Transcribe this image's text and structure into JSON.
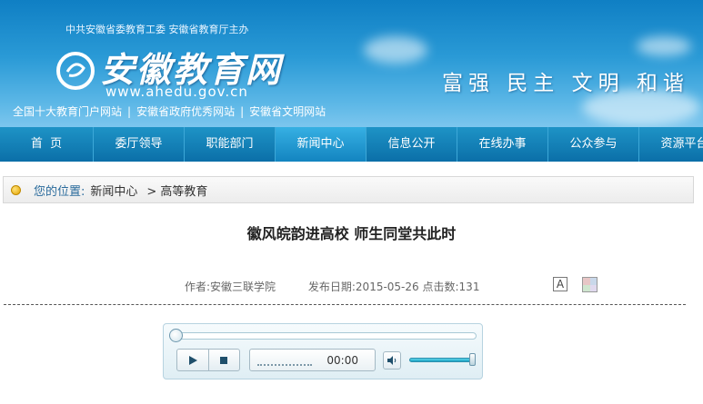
{
  "header": {
    "sponsor": "中共安徽省委教育工委  安徽省教育厅主办",
    "site_name": "安徽教育网",
    "url": "www.ahedu.gov.cn",
    "slogan": "富强 民主 文明 和谐",
    "honors": [
      "全国十大教育门户网站",
      "安徽省政府优秀网站",
      "安徽省文明网站"
    ]
  },
  "nav": {
    "items": [
      {
        "label": "首  页"
      },
      {
        "label": "委厅领导"
      },
      {
        "label": "职能部门"
      },
      {
        "label": "新闻中心",
        "active": true
      },
      {
        "label": "信息公开"
      },
      {
        "label": "在线办事"
      },
      {
        "label": "公众参与"
      },
      {
        "label": "资源平台"
      }
    ]
  },
  "breadcrumb": {
    "label": "您的位置:",
    "items": [
      "新闻中心",
      "> 高等教育"
    ]
  },
  "article": {
    "title": "徽风皖韵进高校 师生同堂共此时",
    "author": "作者:安徽三联学院",
    "publish_date": "发布日期:2015-05-26",
    "clicks": "点击数:131",
    "font_button": "A"
  },
  "player": {
    "time": "00:00",
    "progress": 0,
    "volume": 1.0,
    "icons": [
      "play-icon",
      "stop-icon",
      "volume-icon"
    ]
  },
  "colors": {
    "banner_top": "#0f7fc4",
    "nav": "#0b6fa8",
    "nav_active": "#36b0e3",
    "breadcrumb_label": "#2a6b9c"
  }
}
